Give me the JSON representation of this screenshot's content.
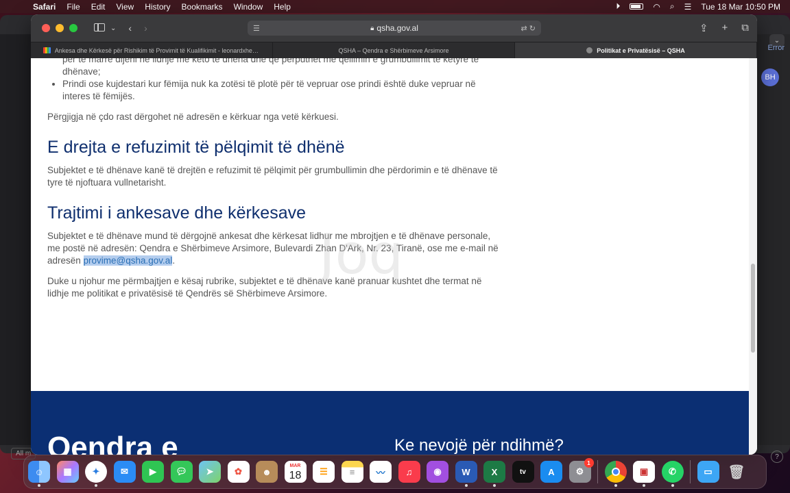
{
  "menubar": {
    "app": "Safari",
    "items": [
      "File",
      "Edit",
      "View",
      "History",
      "Bookmarks",
      "Window",
      "Help"
    ],
    "datetime": "Tue 18 Mar  10:50 PM"
  },
  "background_window": {
    "error_text": "Error",
    "avatar": "BH",
    "all_button": "All m",
    "help": "?"
  },
  "browser": {
    "url": "qsha.gov.al",
    "tabs": [
      {
        "label": "Ankesa dhe Kërkesë për Rishikim të Provimit të Kualifikimit - leonardxhebe...",
        "active": false
      },
      {
        "label": "QSHA – Qendra e Shërbimeve Arsimore",
        "active": false
      },
      {
        "label": "Politikat e Privatësisë – QSHA",
        "active": true
      }
    ]
  },
  "page": {
    "list_items": [
      "për të marrë dijeni në lidhje me këto të dhëna dhe që përputhet me qëllimin e grumbullimit të këtyre të dhënave;",
      "Prindi ose kujdestari kur fëmija nuk ka zotësi të plotë për të vepruar ose prindi është duke vepruar në interes të fëmijës."
    ],
    "para1": "Përgjigja në çdo rast dërgohet në adresën e kërkuar nga vetë kërkuesi.",
    "heading1": "E drejta e refuzimit të pëlqimit të dhënë",
    "para2": "Subjektet e të dhënave kanë të drejtën e refuzimit të pëlqimit për grumbullimin dhe përdorimin e të dhënave të tyre të njoftuara vullnetarisht.",
    "heading2": "Trajtimi i ankesave dhe kërkesave",
    "para3_pre": "Subjektet e të dhënave mund të dërgojnë ankesat dhe kërkesat lidhur me mbrojtjen e të dhënave personale, me postë në adresën: Qendra e Shërbimeve Arsimore, Bulevardi Zhan D'Ark, Nr. 23, Tiranë, ose me e-mail në adresën ",
    "para3_email": "provime@qsha.gov.al",
    "para3_post": ".",
    "para4": "Duke u njohur me përmbajtjen e kësaj rubrike, subjektet e të dhënave kanë pranuar kushtet dhe termat në lidhje me politikat e privatësisë të Qendrës së Shërbimeve Arsimore.",
    "footer_title": "Qendra e",
    "footer_help": "Ke nevojë për ndihmë?"
  },
  "dock": {
    "calendar_month": "MAR",
    "calendar_day": "18",
    "settings_badge": "1"
  }
}
